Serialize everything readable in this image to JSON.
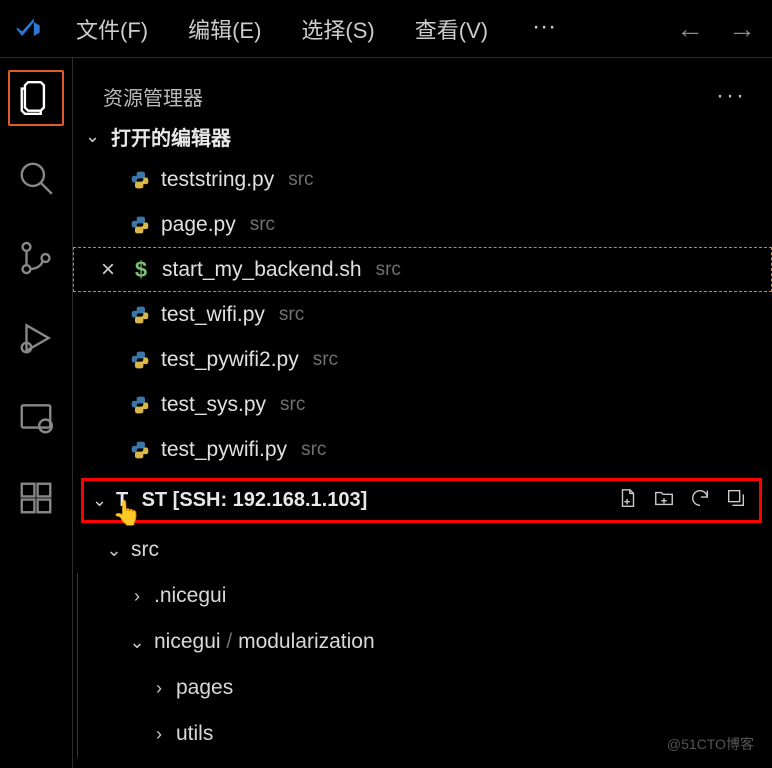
{
  "menubar": {
    "items": [
      "文件(F)",
      "编辑(E)",
      "选择(S)",
      "查看(V)"
    ],
    "overflow": "···"
  },
  "nav": {
    "back": "←",
    "forward": "→"
  },
  "sidebar": {
    "title": "资源管理器",
    "dots": "···"
  },
  "open_editors": {
    "label": "打开的编辑器",
    "items": [
      {
        "name": "teststring.py",
        "dir": "src",
        "icon": "python",
        "active": false
      },
      {
        "name": "page.py",
        "dir": "src",
        "icon": "python",
        "active": false
      },
      {
        "name": "start_my_backend.sh",
        "dir": "src",
        "icon": "sh",
        "active": true
      },
      {
        "name": "test_wifi.py",
        "dir": "src",
        "icon": "python",
        "active": false
      },
      {
        "name": "test_pywifi2.py",
        "dir": "src",
        "icon": "python",
        "active": false
      },
      {
        "name": "test_sys.py",
        "dir": "src",
        "icon": "python",
        "active": false
      },
      {
        "name": "test_pywifi.py",
        "dir": "src",
        "icon": "python",
        "active": false
      }
    ]
  },
  "folder": {
    "label_prefix": "T",
    "label_suffix": "ST [SSH: 192.168.1.103]"
  },
  "tree": {
    "src": "src",
    "nicegui_hidden": ".nicegui",
    "nicegui_mod_a": "nicegui",
    "nicegui_mod_sep": " / ",
    "nicegui_mod_b": "modularization",
    "pages": "pages",
    "utils": "utils"
  },
  "watermark": "@51CTO博客"
}
